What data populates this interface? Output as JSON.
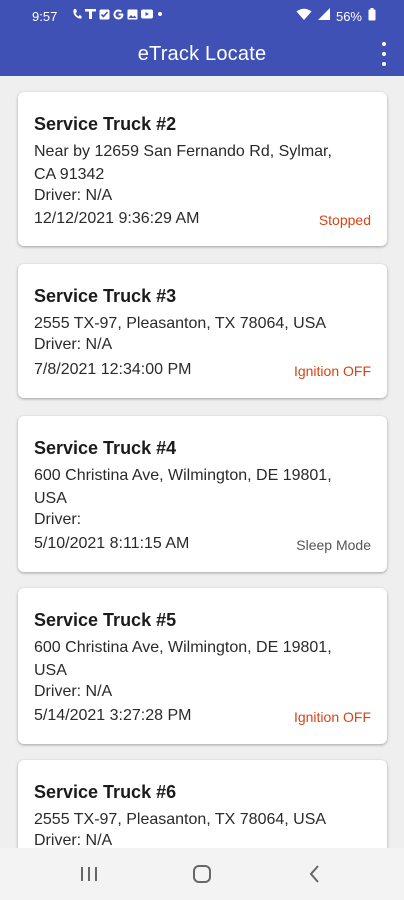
{
  "status_bar": {
    "time": "9:57",
    "battery": "56%",
    "notification_icons": [
      "phone-icon",
      "t-mobile-icon",
      "checkbox-icon",
      "google-icon",
      "image-icon",
      "youtube-icon",
      "dot-icon"
    ]
  },
  "app_bar": {
    "title": "eTrack Locate"
  },
  "colors": {
    "primary": "#3f51b5",
    "status_red": "#d84315",
    "status_gray": "#555555"
  },
  "trucks": [
    {
      "name": "Service Truck #2",
      "address_lines": [
        "Near by 12659 San Fernando Rd, Sylmar,",
        "CA 91342"
      ],
      "driver": "Driver: N/A",
      "datetime": "12/12/2021 9:36:29 AM",
      "status": "Stopped",
      "status_tone": "red"
    },
    {
      "name": "Service Truck #3",
      "address_lines": [
        "2555 TX-97, Pleasanton, TX 78064, USA"
      ],
      "driver": "Driver: N/A",
      "datetime": "7/8/2021 12:34:00 PM",
      "status": "Ignition OFF",
      "status_tone": "red"
    },
    {
      "name": "Service Truck #4",
      "address_lines": [
        "600 Christina Ave, Wilmington, DE 19801,",
        "USA"
      ],
      "driver": "Driver:",
      "datetime": "5/10/2021 8:11:15 AM",
      "status": "Sleep Mode",
      "status_tone": "gray"
    },
    {
      "name": "Service Truck #5",
      "address_lines": [
        "600 Christina Ave, Wilmington, DE 19801,",
        "USA"
      ],
      "driver": "Driver: N/A",
      "datetime": "5/14/2021 3:27:28 PM",
      "status": "Ignition OFF",
      "status_tone": "red"
    },
    {
      "name": "Service Truck #6",
      "address_lines": [
        "2555 TX-97, Pleasanton, TX 78064, USA"
      ],
      "driver": "Driver: N/A"
    }
  ]
}
